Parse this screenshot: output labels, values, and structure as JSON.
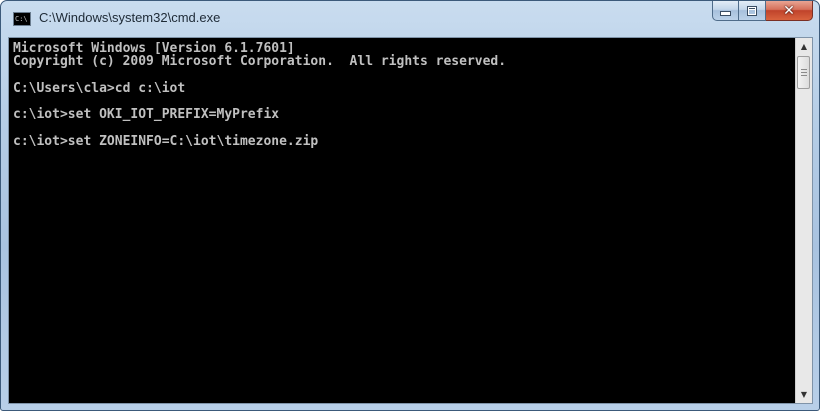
{
  "window": {
    "title": "C:\\Windows\\system32\\cmd.exe",
    "icon": "cmd-console-icon",
    "icon_text": "C:\\",
    "controls": {
      "minimize_icon": "minimize-icon",
      "maximize_icon": "maximize-icon",
      "close_icon": "close-icon",
      "close_glyph": "✕"
    }
  },
  "console": {
    "background": "#000000",
    "foreground": "#c0c0c0",
    "lines": [
      "Microsoft Windows [Version 6.1.7601]",
      "Copyright (c) 2009 Microsoft Corporation.  All rights reserved.",
      "",
      "C:\\Users\\cla>cd c:\\iot",
      "",
      "c:\\iot>set OKI_IOT_PREFIX=MyPrefix",
      "",
      "c:\\iot>set ZONEINFO=C:\\iot\\timezone.zip",
      ""
    ]
  },
  "scrollbar": {
    "up_glyph": "▲",
    "down_glyph": "▼"
  },
  "colors": {
    "title_bar": "#b5cde6",
    "close_button": "#c0432b"
  }
}
